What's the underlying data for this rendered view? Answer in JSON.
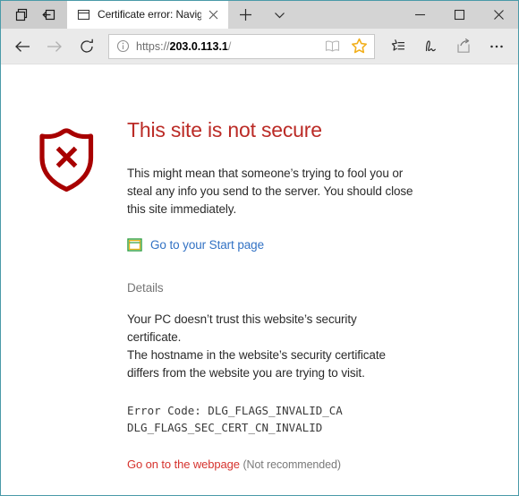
{
  "window": {
    "border_color": "#4a9aa8",
    "controls": {
      "minimize": "−",
      "maximize": "□",
      "close": "✕"
    }
  },
  "tabstrip": {
    "set_aside_tabs_label": "Show tabs you've set aside",
    "set_these_aside_label": "Set these tabs aside",
    "tab": {
      "title": "Certificate error: Naviga",
      "close_label": "Close tab",
      "favicon": "page-icon"
    },
    "new_tab_label": "+",
    "tab_menu_label": "⌄"
  },
  "toolbar": {
    "back_label": "Back",
    "forward_label": "Forward",
    "refresh_label": "Refresh",
    "address": {
      "info_icon": "info-circle-icon",
      "scheme": "https://",
      "host": "203.0.113.1",
      "path": "/",
      "reading_view_label": "Reading view",
      "favorite_label": "Add to favorites or reading list"
    },
    "hub_label": "Hub (favorites, reading list, history and downloads)",
    "web_note_label": "Make a Web Note",
    "share_label": "Share",
    "settings_label": "Settings and more"
  },
  "page": {
    "icon": "shield-error-icon",
    "title": "This site is not secure",
    "lede": "This might mean that someone’s trying to fool you or steal any info you send to the server. You should close this site immediately.",
    "start_link": {
      "icon": "start-page-icon",
      "label": "Go to your Start page"
    },
    "details_heading": "Details",
    "details_lines": [
      "Your PC doesn’t trust this website’s security",
      "certificate.",
      "The hostname in the website’s security certificate",
      "differs from the website you are trying to visit."
    ],
    "error_code_lines": [
      "Error Code: DLG_FLAGS_INVALID_CA",
      "DLG_FLAGS_SEC_CERT_CN_INVALID"
    ],
    "proceed_link": "Go on to the webpage",
    "proceed_note": "(Not recommended)"
  },
  "colors": {
    "title_red": "#bb2b26",
    "shield_red": "#a80000",
    "link_blue": "#3272c4",
    "proceed_red": "#d6332e",
    "details_gray": "#767676",
    "window_border": "#4a9aa8"
  }
}
